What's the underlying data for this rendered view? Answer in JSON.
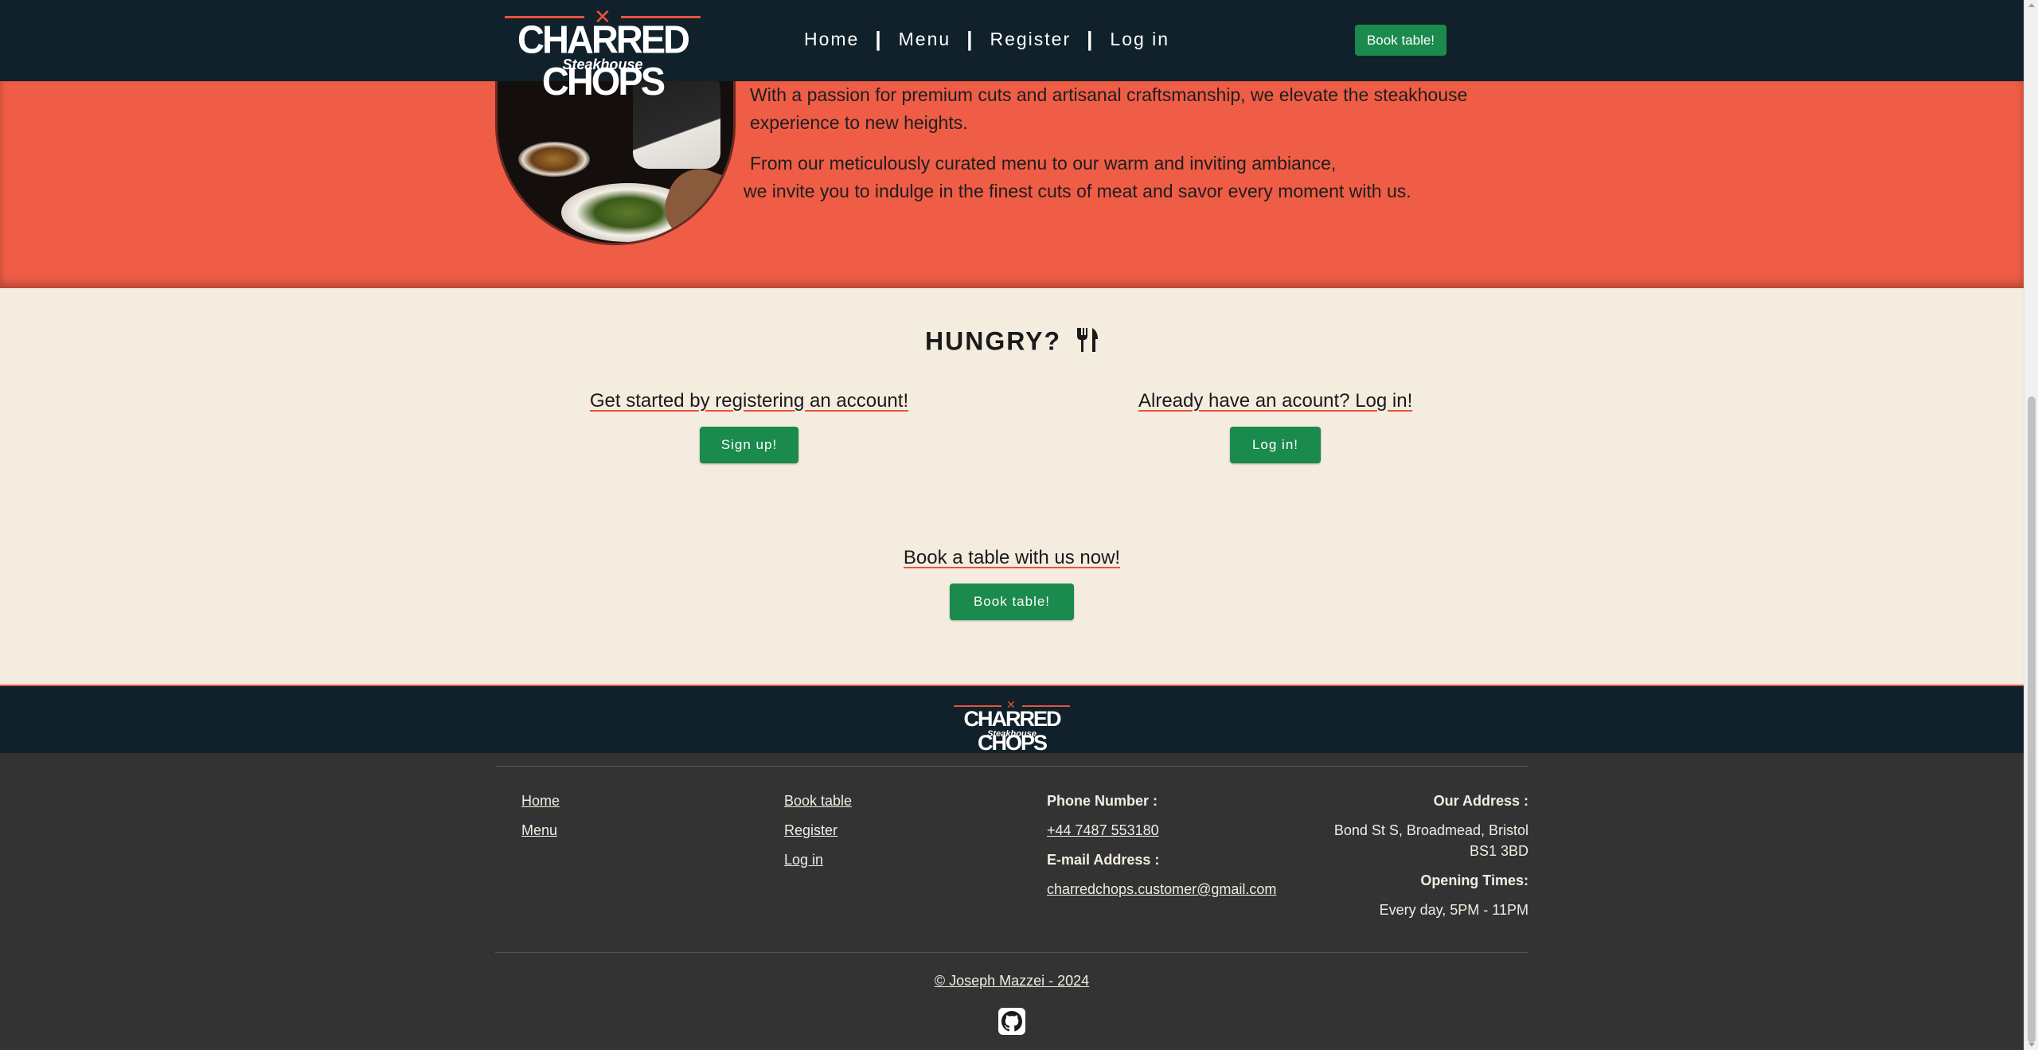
{
  "brand": {
    "name": "CHARRED CHOPS",
    "tagline": "Steakhouse"
  },
  "nav": {
    "items": [
      {
        "label": "Home"
      },
      {
        "label": "Menu"
      },
      {
        "label": "Register"
      },
      {
        "label": "Log in"
      }
    ],
    "separator": "|",
    "book_button": "Book table!"
  },
  "about": {
    "paragraph1": "With a passion for premium cuts and artisanal craftsmanship, we elevate the steakhouse experience to new heights.",
    "paragraph2_line1": "From our meticulously curated menu to our warm and inviting ambiance,",
    "paragraph2_line2": "we invite you to indulge in the finest cuts of meat and savor every moment with us."
  },
  "hungry": {
    "title": "HUNGRY?",
    "register_text": "Get started by registering an account!",
    "register_button": "Sign up!",
    "login_text": "Already have an acount? Log in!",
    "login_button": "Log in!",
    "book_text": "Book a table with us now!",
    "book_button": "Book table!"
  },
  "footer": {
    "col1": [
      "Home",
      "Menu"
    ],
    "col2": [
      "Book table",
      "Register",
      "Log in"
    ],
    "phone_label": "Phone Number :",
    "phone": "+44 7487 553180",
    "email_label": "E-mail Address :",
    "email": "charredchops.customer@gmail.com",
    "address_label": "Our Address :",
    "address": "Bond St S, Broadmead, Bristol BS1 3BD",
    "hours_label": "Opening Times:",
    "hours": "Every day, 5PM - 11PM",
    "copyright": "© Joseph Mazzei - 2024"
  },
  "colors": {
    "navy": "#10212b",
    "accent_red": "#ef5d46",
    "cta_green": "#1a8a4d",
    "cream": "#f5ece0",
    "footer_grey": "#333333"
  },
  "icons": [
    "cutlery-icon",
    "github-icon"
  ]
}
